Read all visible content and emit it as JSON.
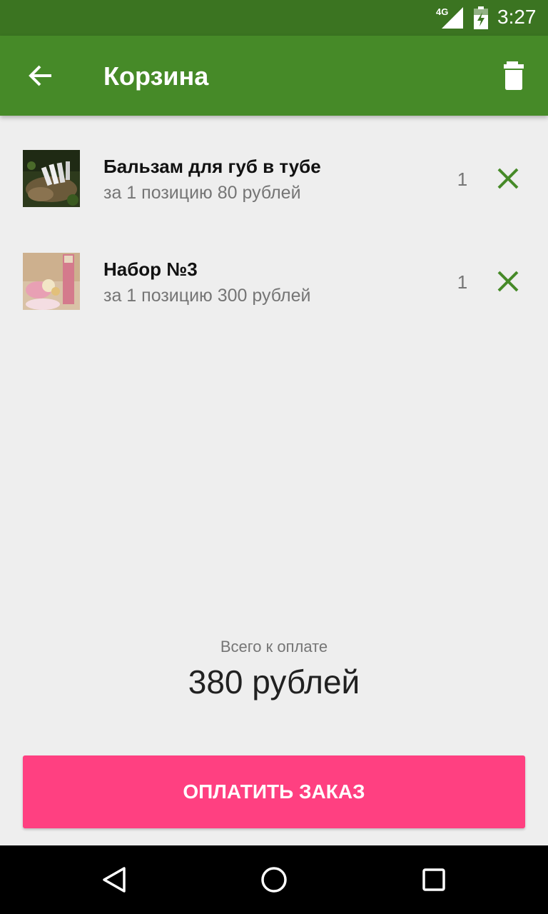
{
  "status_bar": {
    "network": "4G",
    "time": "3:27"
  },
  "app_bar": {
    "title": "Корзина",
    "back_icon": "arrow-back-icon",
    "action_icon": "trash-icon"
  },
  "cart": {
    "items": [
      {
        "name": "Бальзам для губ в тубе",
        "price": "за 1 позицию 80 рублей",
        "quantity": "1",
        "image": "product-photo-lip-balm",
        "remove_icon": "close-icon"
      },
      {
        "name": "Набор №3",
        "price": "за 1 позицию 300 рублей",
        "quantity": "1",
        "image": "product-photo-set-3",
        "remove_icon": "close-icon"
      }
    ]
  },
  "total": {
    "label": "Всего к оплате",
    "value": "380 рублей"
  },
  "pay_button": {
    "label": "ОПЛАТИТЬ ЗАКАЗ"
  },
  "colors": {
    "status_bar": "#3b7421",
    "app_bar": "#468a28",
    "accent_green": "#468a28",
    "pay_button": "#ff4081",
    "background": "#eeeeee"
  },
  "nav_bar": {
    "icons": [
      "back-triangle-icon",
      "home-circle-icon",
      "recents-square-icon"
    ]
  }
}
